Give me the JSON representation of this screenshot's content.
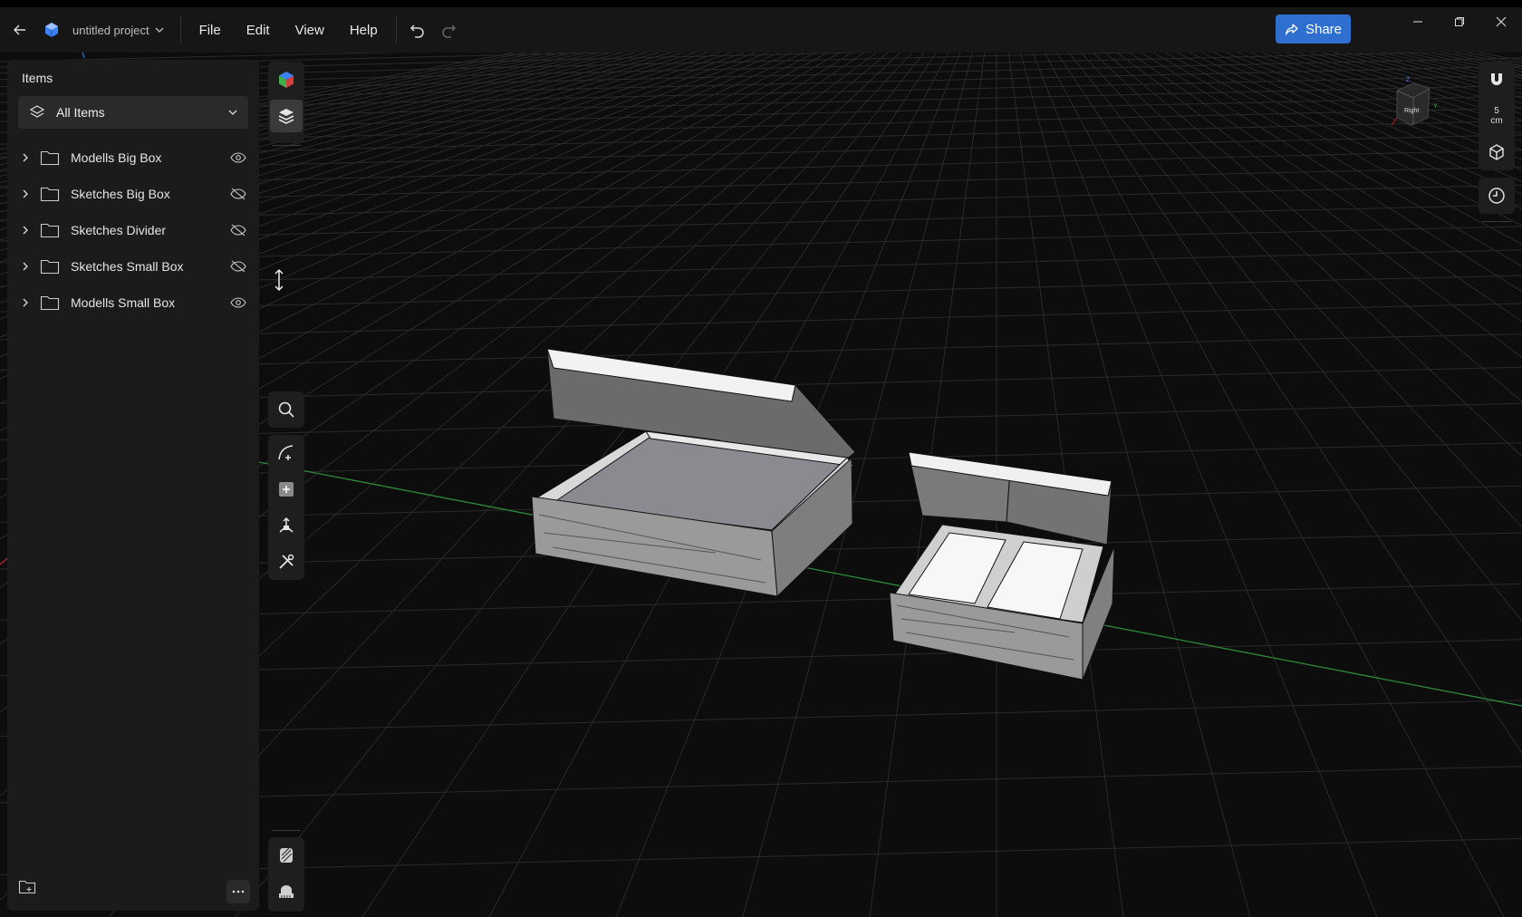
{
  "titlebar": {
    "project_name": "untitled project",
    "menu": [
      "File",
      "Edit",
      "View",
      "Help"
    ],
    "share_label": "Share"
  },
  "panel": {
    "title": "Items",
    "filter_value": "All Items",
    "items": [
      {
        "label": "Modells Big Box",
        "visible": true
      },
      {
        "label": "Sketches Big Box",
        "visible": false
      },
      {
        "label": "Sketches Divider",
        "visible": false
      },
      {
        "label": "Sketches Small Box",
        "visible": false
      },
      {
        "label": "Modells Small Box",
        "visible": true
      }
    ]
  },
  "right_toolbar": {
    "grid_value": "5",
    "grid_unit": "cm"
  },
  "view_cube": {
    "face_label": "Right",
    "axis_z": "Z",
    "axis_y": "Y"
  },
  "icons": {
    "back": "arrow-left-icon",
    "logo": "app-logo-icon",
    "undo": "undo-icon",
    "redo": "redo-icon",
    "share": "share-icon",
    "tools": [
      "render-icon",
      "layers-icon",
      "search-icon",
      "sketch-icon",
      "add-primitive-icon",
      "transform-icon",
      "tools-icon",
      "materials-icon",
      "measure-icon"
    ],
    "right": [
      "snap-magnet-icon",
      "grid-unit-icon",
      "view-mode-icon",
      "history-icon"
    ]
  },
  "colors": {
    "accent": "#2f6fd0",
    "axis_green": "#2f8a3a",
    "axis_red": "#b3262e"
  }
}
